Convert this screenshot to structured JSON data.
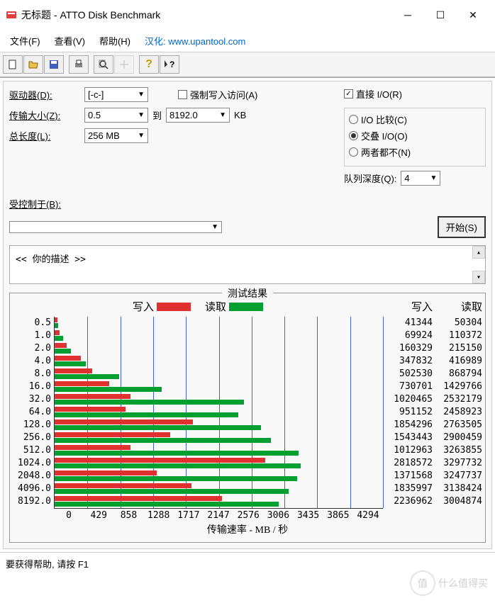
{
  "window": {
    "title": "无标题 - ATTO Disk Benchmark"
  },
  "menu": {
    "file": "文件(F)",
    "view": "查看(V)",
    "help": "帮助(H)",
    "localization": "汉化: www.upantool.com"
  },
  "form": {
    "drive_label": "驱动器(D):",
    "drive_value": "[-c-]",
    "transfer_label": "传输大小(Z):",
    "transfer_from": "0.5",
    "to_label": "到",
    "transfer_to": "8192.0",
    "kb_label": "KB",
    "length_label": "总长度(L):",
    "length_value": "256 MB",
    "force_write": "强制写入访问(A)",
    "direct_io": "直接 I/O(R)",
    "io_compare": "I/O 比较(C)",
    "overlap_io": "交叠 I/O(O)",
    "neither": "两者都不(N)",
    "queue_depth_label": "队列深度(Q):",
    "queue_depth_value": "4",
    "controlled_label": "受控制于(B):",
    "start_button": "开始(S)",
    "description": "<<   你的描述   >>"
  },
  "results": {
    "title": "测试结果",
    "write_label": "写入",
    "read_label": "读取",
    "x_title": "传输速率 - MB / 秒"
  },
  "chart_data": {
    "type": "bar",
    "orientation": "horizontal",
    "categories": [
      "0.5",
      "1.0",
      "2.0",
      "4.0",
      "8.0",
      "16.0",
      "32.0",
      "64.0",
      "128.0",
      "256.0",
      "512.0",
      "1024.0",
      "2048.0",
      "4096.0",
      "8192.0"
    ],
    "series": [
      {
        "name": "写入",
        "color": "#e03030",
        "values_kb": [
          41344,
          69924,
          160329,
          347832,
          502530,
          730701,
          1020465,
          951152,
          1854296,
          1543443,
          1012963,
          2818572,
          1371568,
          1835997,
          2236962
        ]
      },
      {
        "name": "读取",
        "color": "#00a030",
        "values_kb": [
          50304,
          110372,
          215150,
          416989,
          868794,
          1429766,
          2532179,
          2458923,
          2763505,
          2900459,
          3263855,
          3297732,
          3247737,
          3138424,
          3004874
        ]
      }
    ],
    "x_ticks": [
      0,
      429,
      858,
      1288,
      1717,
      2147,
      2576,
      3006,
      3435,
      3865,
      4294
    ],
    "xlabel": "传输速率 - MB / 秒",
    "x_max_mb": 4294
  },
  "statusbar": "要获得帮助, 请按 F1",
  "watermark": "什么值得买"
}
